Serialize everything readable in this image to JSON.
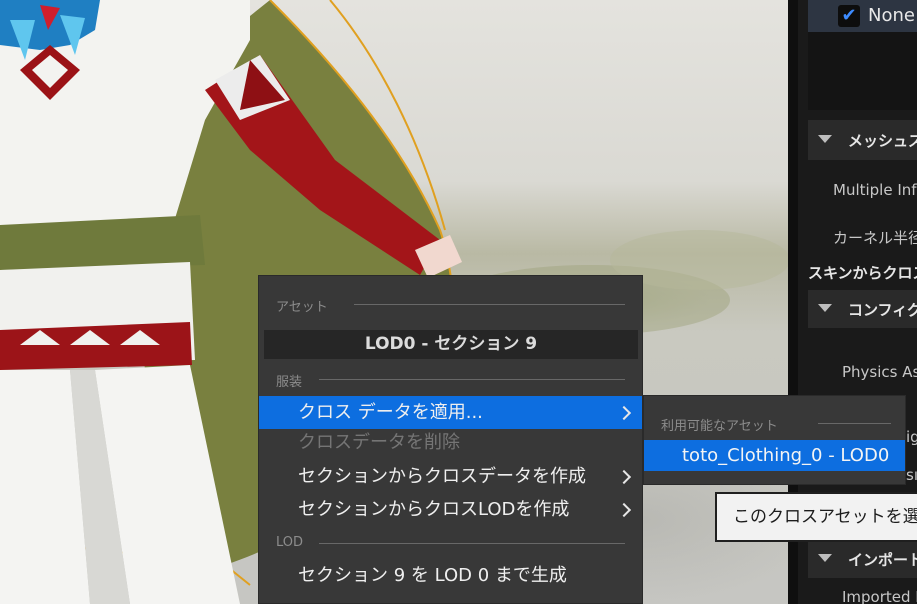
{
  "details_panel": {
    "none_label": "None",
    "mesh_section_header": "メッシュス",
    "multiple_influences_label": "Multiple Influ",
    "kernel_radius_label": "カーネル半径",
    "skin_to_cloth_label": "スキンからクロス",
    "config_header": "コンフィグ",
    "physics_asset_label": "Physics Ass",
    "partial_label_1": "ig",
    "partial_label_2": "sı",
    "import_header": "インポート",
    "imported_file_label": "Imported Fil"
  },
  "context_menu": {
    "asset_section_label": "アセット",
    "lod_section_title": "LOD0 - セクション 9",
    "clothing_section_label": "服装",
    "items": [
      {
        "label": "クロス データを適用...",
        "highlighted": true,
        "enabled": true,
        "has_submenu": true
      },
      {
        "label": "クロスデータを削除",
        "highlighted": false,
        "enabled": false,
        "has_submenu": false
      },
      {
        "label": "セクションからクロスデータを作成",
        "highlighted": false,
        "enabled": true,
        "has_submenu": true
      },
      {
        "label": "セクションからクロスLODを作成",
        "highlighted": false,
        "enabled": true,
        "has_submenu": true
      }
    ],
    "lod_section_label": "LOD",
    "generate_item_label": "セクション 9 を LOD 0 まで生成"
  },
  "submenu": {
    "section_label": "利用可能なアセット",
    "item_label": "toto_Clothing_0 - LOD0"
  },
  "tooltip": {
    "text": "このクロスアセットを選択"
  },
  "colors": {
    "highlight": "#0d6ee0",
    "menu_background": "#383838",
    "panel_background": "#1a1a1a",
    "checkbox_check": "#3d8bff"
  }
}
